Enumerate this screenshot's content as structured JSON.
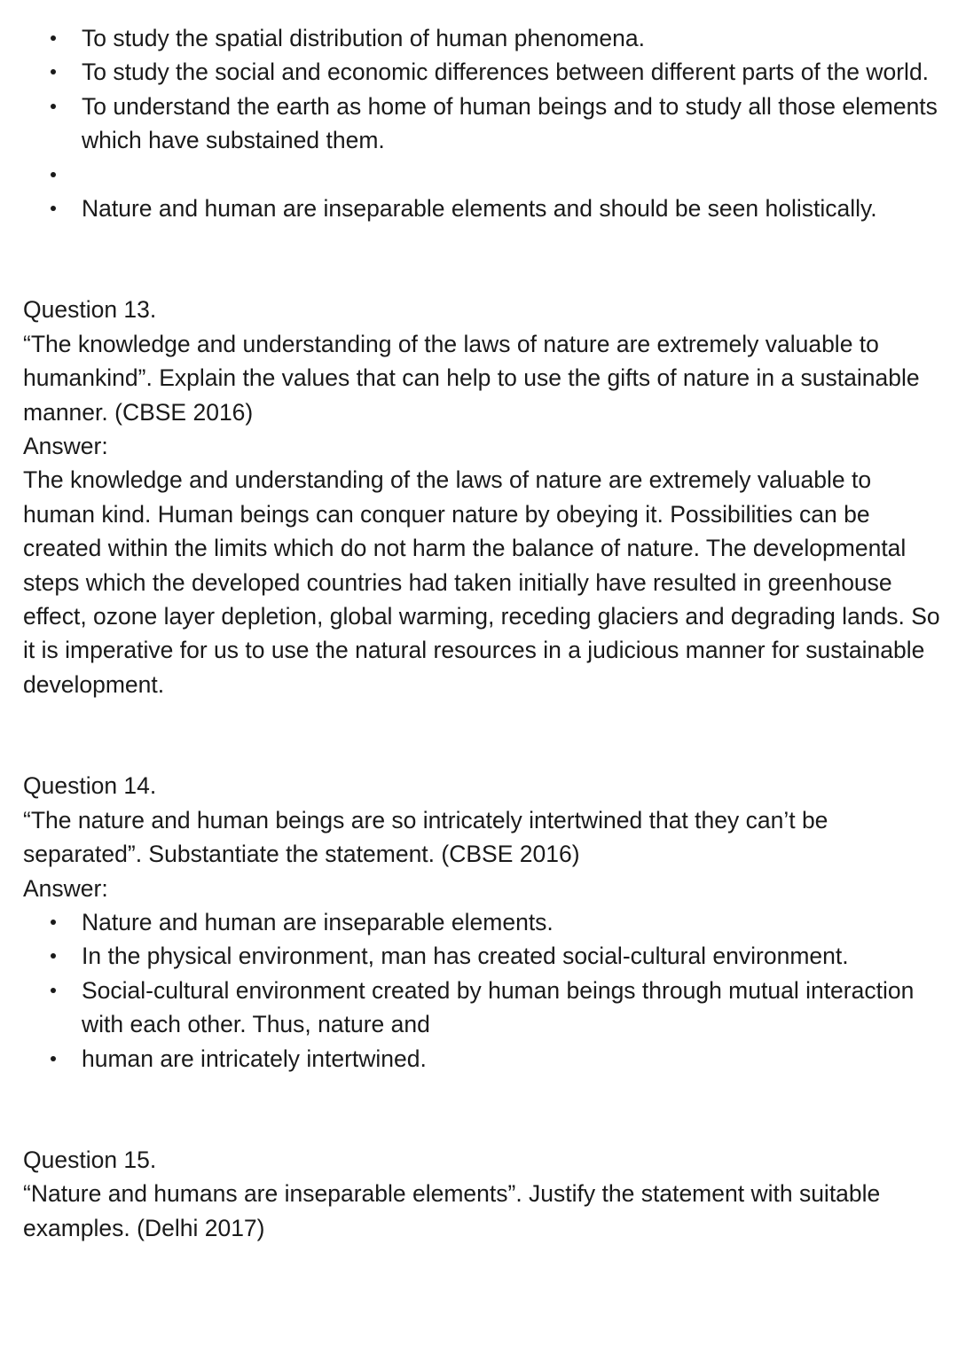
{
  "intro_bullets": [
    "To study the spatial distribution of human phenomena.",
    "To study the social and economic differences between different parts of the world.",
    "To understand the earth as home of human beings and to study all those elements which have substained them.",
    "",
    "Nature and human are inseparable elements and should be seen holistically."
  ],
  "q13": {
    "heading": "Question 13.",
    "text": "“The knowledge and understanding of the laws of nature are extremely valuable to humankind”. Explain the values that can help to use the gifts of nature in a sustainable manner. (CBSE 2016)",
    "answer_label": "Answer:",
    "answer": "The knowledge and understanding of the laws of nature are extremely valuable to human kind. Human beings can conquer nature by obeying it. Possibilities can be created within the limits which do not harm the balance of nature. The developmental steps which the developed countries had taken initially have resulted in greenhouse effect, ozone layer depletion, global warming, receding glaciers and degrading lands. So it is imperative for us to use the natural resources in a judicious manner for sustainable development."
  },
  "q14": {
    "heading": "Question 14.",
    "text": "“The nature and human beings are so intricately intertwined that they can’t be separated”. Substantiate the statement. (CBSE 2016)",
    "answer_label": "Answer:",
    "bullets": [
      "Nature and human are inseparable elements.",
      "In the physical environment, man has created social-cultural environment.",
      "Social-cultural environment created by human beings through mutual interaction with each other. Thus, nature and",
      "human are intricately intertwined."
    ]
  },
  "q15": {
    "heading": "Question 15.",
    "text": "“Nature and humans are inseparable elements”. Justify the statement with suitable examples. (Delhi 2017)"
  }
}
